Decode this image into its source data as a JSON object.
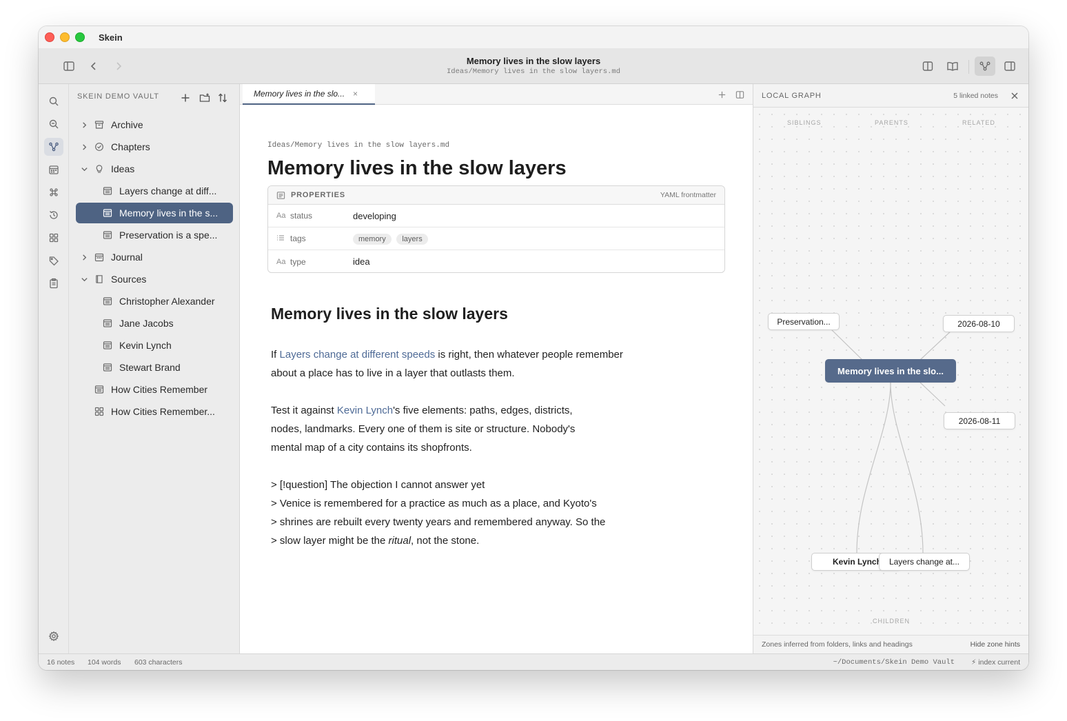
{
  "app": {
    "name": "Skein"
  },
  "toolbar": {
    "title": "Memory lives in the slow layers",
    "path": "Ideas/Memory lives in the slow layers.md"
  },
  "sidebar": {
    "heading": "SKEIN DEMO VAULT",
    "items": [
      {
        "label": "Archive",
        "icon": "archive-icon",
        "chevron": "right"
      },
      {
        "label": "Chapters",
        "icon": "chapters-icon",
        "chevron": "right"
      },
      {
        "label": "Ideas",
        "icon": "lightbulb-icon",
        "chevron": "down"
      },
      {
        "label": "Layers change at diff...",
        "icon": "note-icon"
      },
      {
        "label": "Memory lives in the s...",
        "icon": "note-icon",
        "selected": true
      },
      {
        "label": "Preservation is a spe...",
        "icon": "note-icon"
      },
      {
        "label": "Journal",
        "icon": "calendar-icon",
        "chevron": "right"
      },
      {
        "label": "Sources",
        "icon": "book-icon",
        "chevron": "down"
      },
      {
        "label": "Christopher Alexander",
        "icon": "note-icon"
      },
      {
        "label": "Jane Jacobs",
        "icon": "note-icon"
      },
      {
        "label": "Kevin Lynch",
        "icon": "note-icon"
      },
      {
        "label": "Stewart Brand",
        "icon": "note-icon"
      },
      {
        "label": "How Cities Remember",
        "icon": "note-icon"
      },
      {
        "label": "How Cities Remember...",
        "icon": "canvas-icon"
      }
    ]
  },
  "editor": {
    "tab_label": "Memory lives in the slo...",
    "tab_close": "×",
    "doc_path": "Ideas/Memory lives in the slow layers.md",
    "doc_title": "Memory lives in the slow layers",
    "properties": {
      "heading": "PROPERTIES",
      "format": "YAML frontmatter",
      "status": {
        "key": "status",
        "type": "Aa",
        "value": "developing"
      },
      "tags": {
        "key": "tags",
        "values": [
          "memory",
          "layers"
        ]
      },
      "type": {
        "key": "type",
        "type": "Aa",
        "value": "idea"
      }
    },
    "heading2": "Memory lives in the slow layers",
    "p1": {
      "pre": "If ",
      "link": "Layers change at different speeds",
      "post": " is right, then whatever people remember about a place has to live in a layer that outlasts them."
    },
    "p2": {
      "pre": "Test it against ",
      "link": "Kevin Lynch",
      "post": "'s five elements: paths, edges, districts, nodes, landmarks. Every one of them is site or structure. Nobody's mental map of a city contains its shopfronts."
    },
    "quote": {
      "line1": "> [!question] The objection I cannot answer yet",
      "line2": "> Venice is remembered for a practice as much as a place, and Kyoto's",
      "line3": "> shrines are rebuilt every twenty years and remembered anyway. So the",
      "line4_pre": "> slow layer might be the ",
      "line4_em": "ritual",
      "line4_post": ", not the stone."
    }
  },
  "graph": {
    "title": "LOCAL GRAPH",
    "count": "5 linked notes",
    "zones": {
      "siblings": "SIBLINGS",
      "parents": "PARENTS",
      "related": "RELATED",
      "children": "CHILDREN"
    },
    "nodes": {
      "center": "Memory lives in the slo...",
      "preservation": "Preservation...",
      "date1": "2026-08-10",
      "date2": "2026-08-11",
      "kevin": "Kevin Lynch",
      "layers": "Layers change at..."
    },
    "footer_left": "Zones inferred from folders, links and headings",
    "footer_right": "Hide zone hints"
  },
  "status": {
    "notes": "16 notes",
    "words": "104 words",
    "chars": "603 characters",
    "vault_path": "~/Documents/Skein Demo Vault",
    "index": "⚡ index current"
  },
  "colors": {
    "accent": "#4e6383",
    "link": "#4e6a96"
  }
}
